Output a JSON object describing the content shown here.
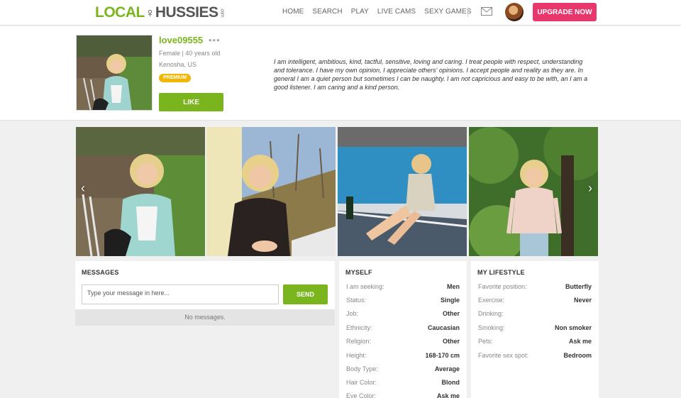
{
  "header": {
    "logo": {
      "part1": "LOCAL",
      "part2": "HUSSIES",
      "suffix": ".com"
    },
    "nav": [
      "HOME",
      "SEARCH",
      "PLAY",
      "LIVE CAMS",
      "SEXY GAMES"
    ],
    "upgrade_label": "UPGRADE NOW"
  },
  "profile": {
    "username": "love09555",
    "menu": "•••",
    "gender_age": "Female | 40 years old",
    "location": "Kenosha, US",
    "badge": "PREMIUM",
    "like_label": "LIKE",
    "bio": "I am intelligent, ambitious, kind, tactful, sensitive, loving and caring. I treat people with respect, understanding and tolerance. I have my own opinion, I appreciate others' opinions. I accept people and reality as they are. In general I am a quiet person but sometimes I can be naughty. I am not capricious and easy to be with, an I am a good listener. I am caring and a kind person."
  },
  "gallery": {
    "prev": "‹",
    "next": "›"
  },
  "messages": {
    "title": "MESSAGES",
    "placeholder": "Type your message in here...",
    "send_label": "SEND",
    "empty": "No messages."
  },
  "myself": {
    "title": "MYSELF",
    "rows": [
      {
        "label": "I am seeking:",
        "value": "Men"
      },
      {
        "label": "Status:",
        "value": "Single"
      },
      {
        "label": "Job:",
        "value": "Other"
      },
      {
        "label": "Ethnicity:",
        "value": "Caucasian"
      },
      {
        "label": "Religion:",
        "value": "Other"
      },
      {
        "label": "Height:",
        "value": "168-170 cm"
      },
      {
        "label": "Body Type:",
        "value": "Average"
      },
      {
        "label": "Hair Color:",
        "value": "Blond"
      },
      {
        "label": "Eye Color:",
        "value": "Ask me"
      }
    ]
  },
  "lifestyle": {
    "title": "MY LIFESTYLE",
    "rows": [
      {
        "label": "Favorite position:",
        "value": "Butterfly"
      },
      {
        "label": "Exercise:",
        "value": "Never"
      },
      {
        "label": "Drinking:",
        "value": ""
      },
      {
        "label": "Smoking:",
        "value": "Non smoker"
      },
      {
        "label": "Pets:",
        "value": "Ask me"
      },
      {
        "label": "Favorite sex spot:",
        "value": "Bedroom"
      }
    ]
  },
  "colors": {
    "accent": "#7ab51d",
    "upgrade": "#e8376c",
    "premium": "#f2b705"
  }
}
